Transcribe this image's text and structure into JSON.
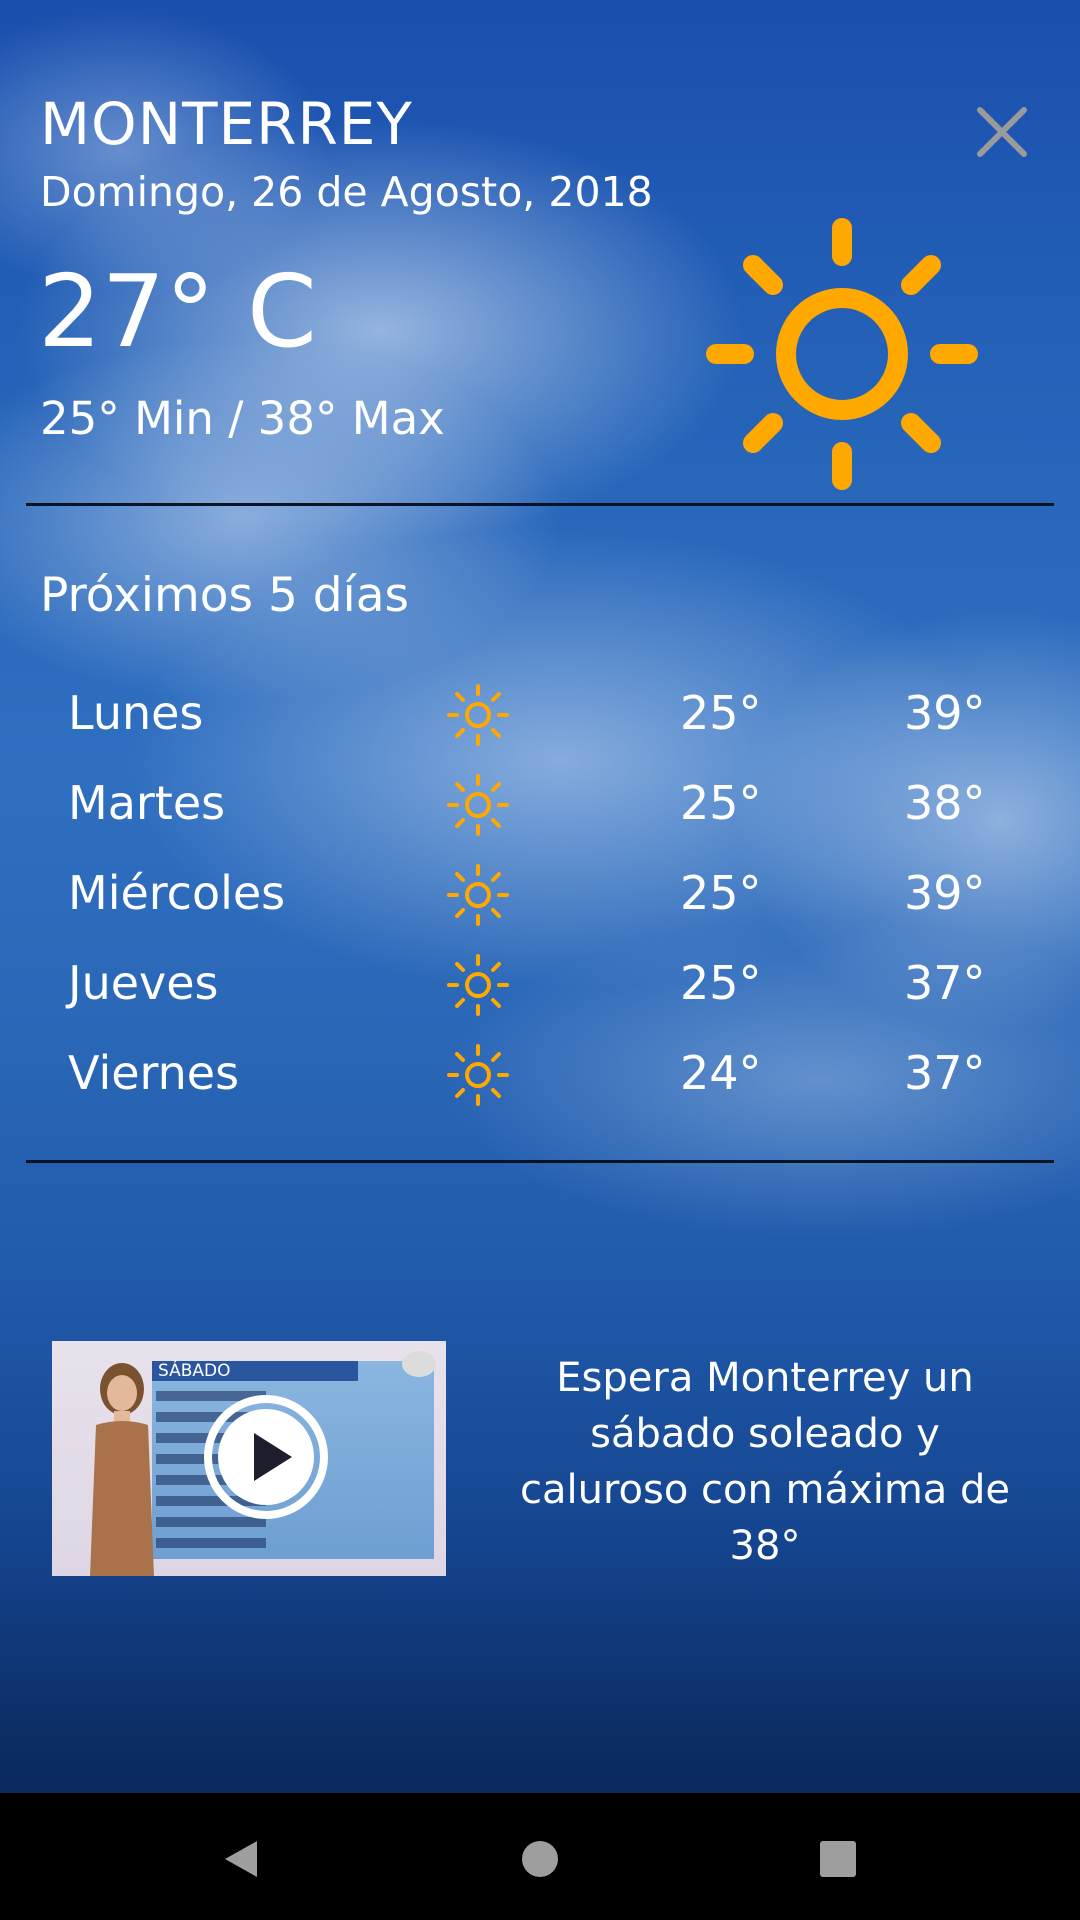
{
  "header": {
    "city": "MONTERREY",
    "date": "Domingo, 26 de Agosto, 2018",
    "temperature": "27° C",
    "min_max": "25° Min / 38° Max",
    "condition_icon": "sun-icon",
    "close_icon": "close-icon"
  },
  "forecast": {
    "title": "Próximos 5 días",
    "days": [
      {
        "day": "Lunes",
        "icon": "sun-icon",
        "min": "25°",
        "max": "39°"
      },
      {
        "day": "Martes",
        "icon": "sun-icon",
        "min": "25°",
        "max": "38°"
      },
      {
        "day": "Miércoles",
        "icon": "sun-icon",
        "min": "25°",
        "max": "39°"
      },
      {
        "day": "Jueves",
        "icon": "sun-icon",
        "min": "25°",
        "max": "37°"
      },
      {
        "day": "Viernes",
        "icon": "sun-icon",
        "min": "24°",
        "max": "37°"
      }
    ]
  },
  "video": {
    "thumbnail_heading": "SÁBADO",
    "caption": "Espera Monterrey un sábado soleado y caluroso con máxima de 38°",
    "play_icon": "play-icon"
  },
  "navbar": {
    "back_icon": "back-triangle-icon",
    "home_icon": "home-circle-icon",
    "recents_icon": "recents-square-icon"
  },
  "colors": {
    "sun": "#FFA800",
    "text": "#FFFFFF",
    "close": "#9A9A9A",
    "navbar": "#000000",
    "nav_icon": "#9E9E9E"
  }
}
